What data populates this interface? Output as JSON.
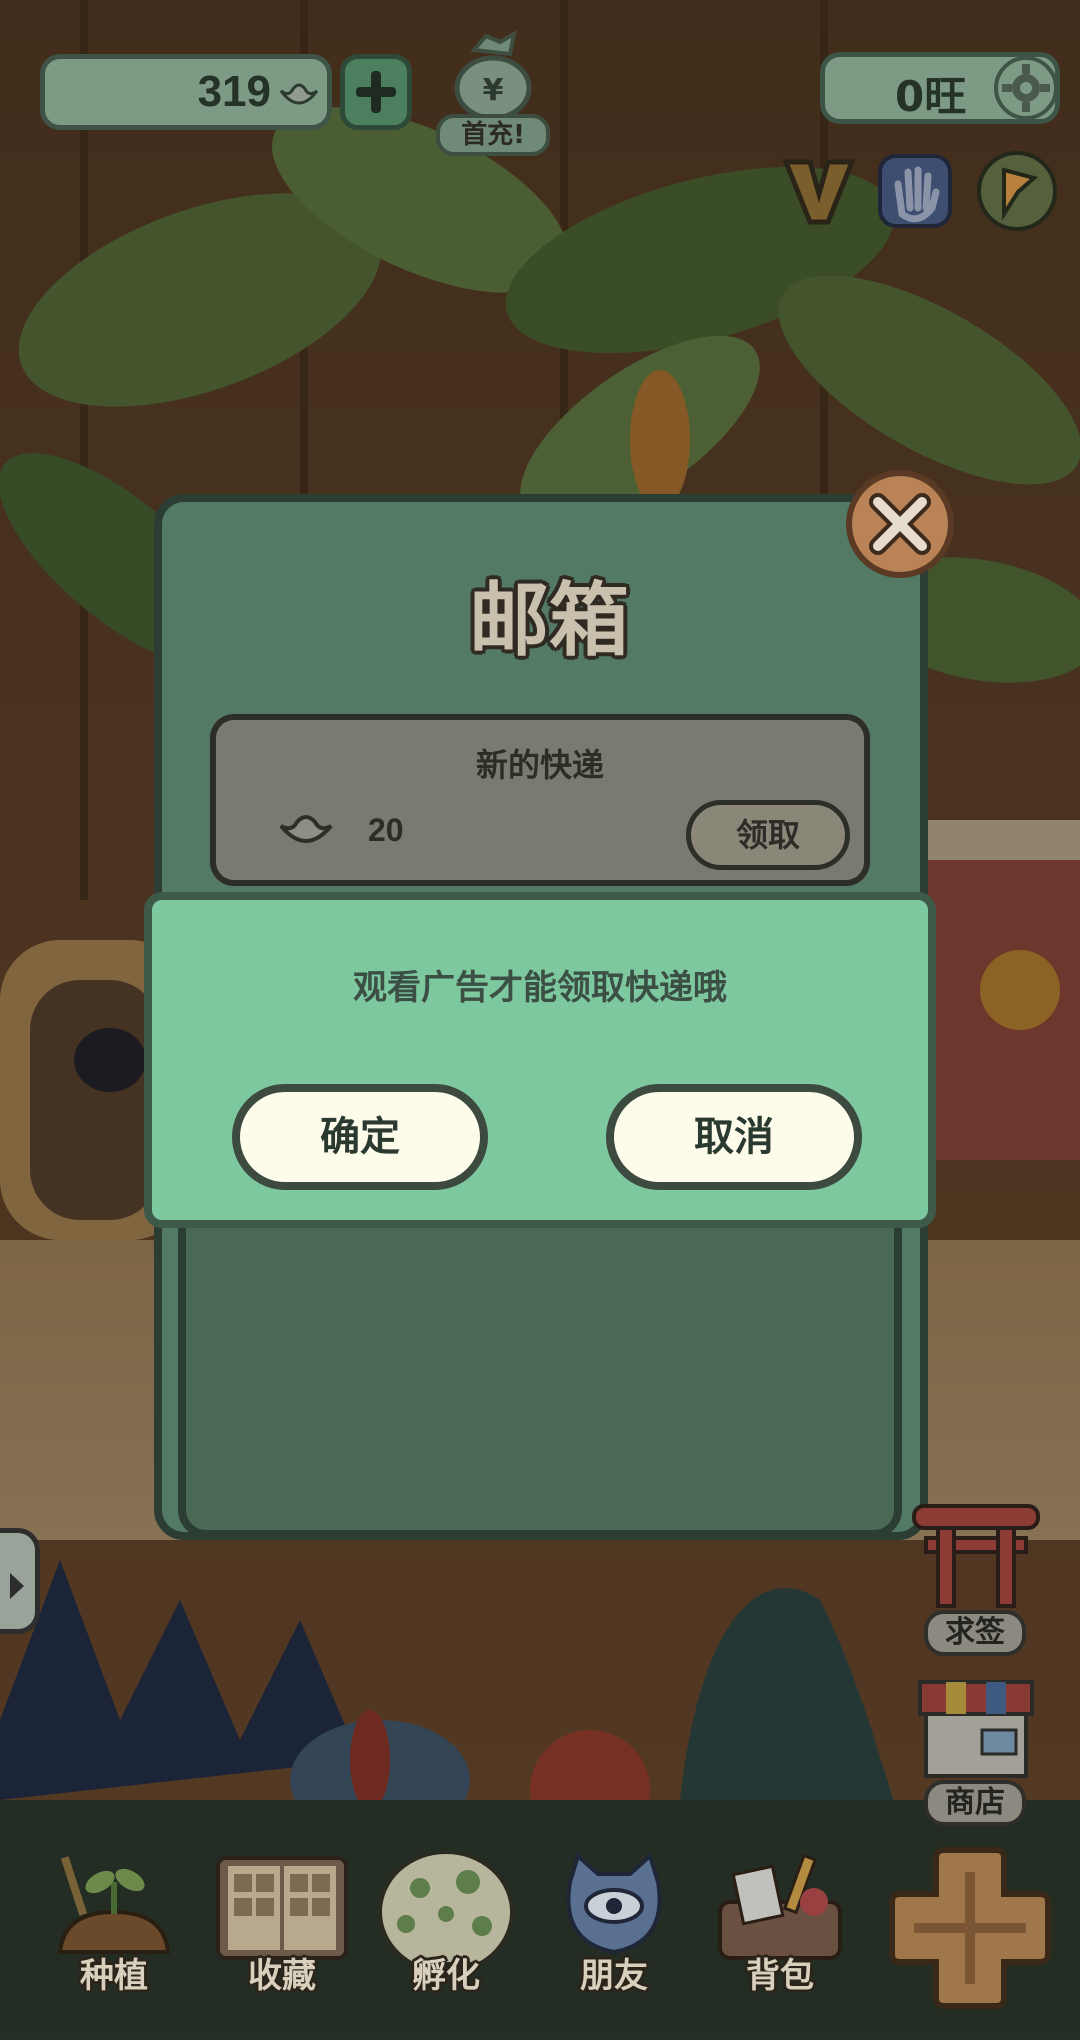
{
  "hud": {
    "coins": "319",
    "points": "0旺",
    "first_charge_label": "首充!",
    "first_charge_symbol": "¥"
  },
  "mailbox": {
    "title": "邮箱",
    "items": [
      {
        "title": "新的快递",
        "reward_icon": "gold-ingot-icon",
        "amount": "20",
        "claim_label": "领取"
      }
    ]
  },
  "dialog": {
    "message": "观看广告才能领取快递哦",
    "confirm_label": "确定",
    "cancel_label": "取消"
  },
  "right_buttons": {
    "fortune_label": "求签",
    "shop_label": "商店"
  },
  "nav": {
    "items": [
      {
        "label": "种植",
        "icon": "plant-icon"
      },
      {
        "label": "收藏",
        "icon": "collection-book-icon"
      },
      {
        "label": "孵化",
        "icon": "egg-icon"
      },
      {
        "label": "朋友",
        "icon": "cat-friend-icon"
      },
      {
        "label": "背包",
        "icon": "backpack-icon"
      }
    ]
  },
  "colors": {
    "panel_green": "#537a64",
    "dialog_green": "#7ec89f",
    "button_cream": "#fdfbe9",
    "close_orange": "#b98257"
  }
}
